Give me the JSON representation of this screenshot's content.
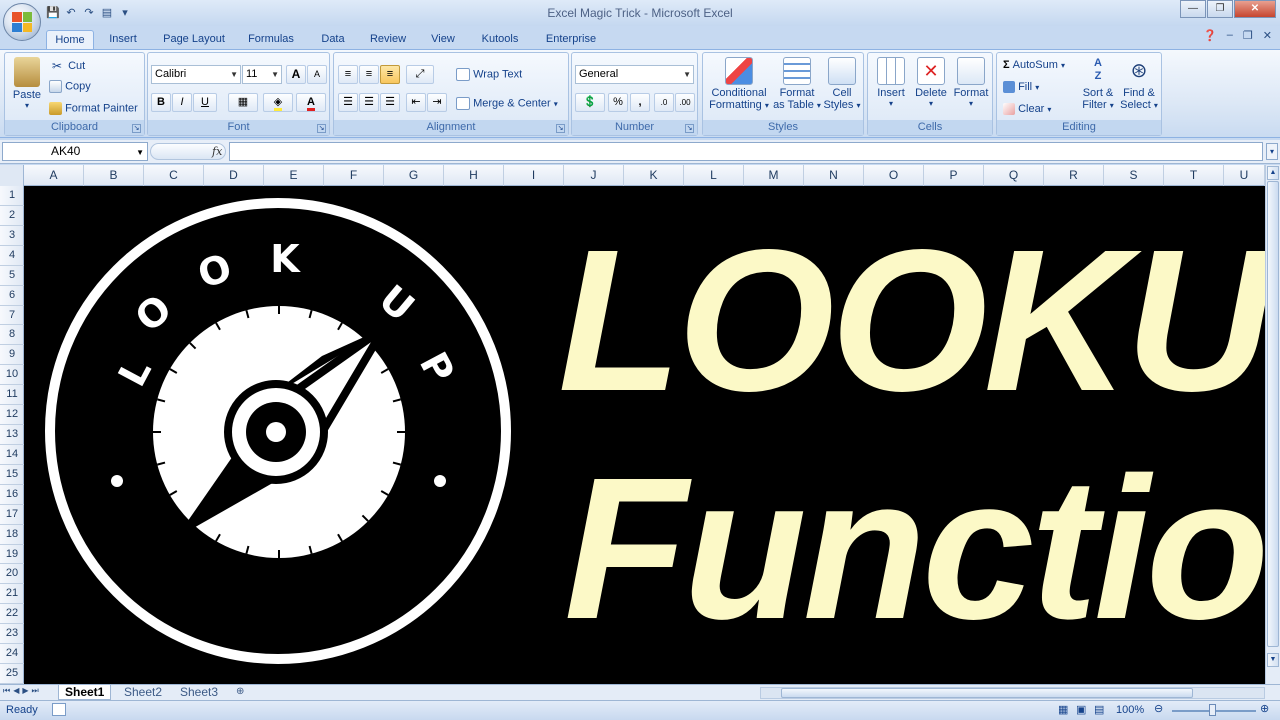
{
  "window": {
    "title": "Excel Magic Trick - Microsoft Excel"
  },
  "tabs": [
    "Home",
    "Insert",
    "Page Layout",
    "Formulas",
    "Data",
    "Review",
    "View",
    "Kutools",
    "Enterprise"
  ],
  "clipboard": {
    "paste": "Paste",
    "cut": "Cut",
    "copy": "Copy",
    "format_painter": "Format Painter",
    "label": "Clipboard"
  },
  "font": {
    "name": "Calibri",
    "size": "11",
    "label": "Font",
    "bold": "B",
    "italic": "I",
    "underline": "U",
    "grow": "A",
    "shrink": "A"
  },
  "alignment": {
    "wrap_text": "Wrap Text",
    "merge_center": "Merge & Center",
    "label": "Alignment"
  },
  "number": {
    "format": "General",
    "label": "Number",
    "percent": "%",
    "comma": ","
  },
  "styles": {
    "conditional": "Conditional",
    "formatting": "Formatting",
    "format_as": "Format",
    "as_table": "as Table",
    "cell": "Cell",
    "cell_styles": "Styles",
    "label": "Styles"
  },
  "cells": {
    "insert": "Insert",
    "delete": "Delete",
    "format": "Format",
    "label": "Cells"
  },
  "editing": {
    "autosum": "AutoSum",
    "fill": "Fill",
    "clear": "Clear",
    "sort": "Sort &",
    "filter": "Filter",
    "find": "Find &",
    "select": "Select",
    "label": "Editing"
  },
  "formula_bar": {
    "name_box": "AK40",
    "fx": "fx",
    "value": ""
  },
  "columns": [
    "A",
    "B",
    "C",
    "D",
    "E",
    "F",
    "G",
    "H",
    "I",
    "J",
    "K",
    "L",
    "M",
    "N",
    "O",
    "P",
    "Q",
    "R",
    "S",
    "T",
    "U"
  ],
  "rows": [
    "1",
    "2",
    "3",
    "4",
    "5",
    "6",
    "7",
    "8",
    "9",
    "10",
    "11",
    "12",
    "13",
    "14",
    "15",
    "16",
    "17",
    "18",
    "19",
    "20",
    "21",
    "22",
    "23",
    "24",
    "25"
  ],
  "graphic": {
    "line1": "LOOKUP",
    "line2": "Function",
    "logo_letters": [
      "L",
      "O",
      "O",
      "K",
      "U",
      "P"
    ]
  },
  "sheets": [
    "Sheet1",
    "Sheet2",
    "Sheet3"
  ],
  "active_sheet": "Sheet1",
  "status": {
    "mode": "Ready",
    "zoom": "100%"
  }
}
